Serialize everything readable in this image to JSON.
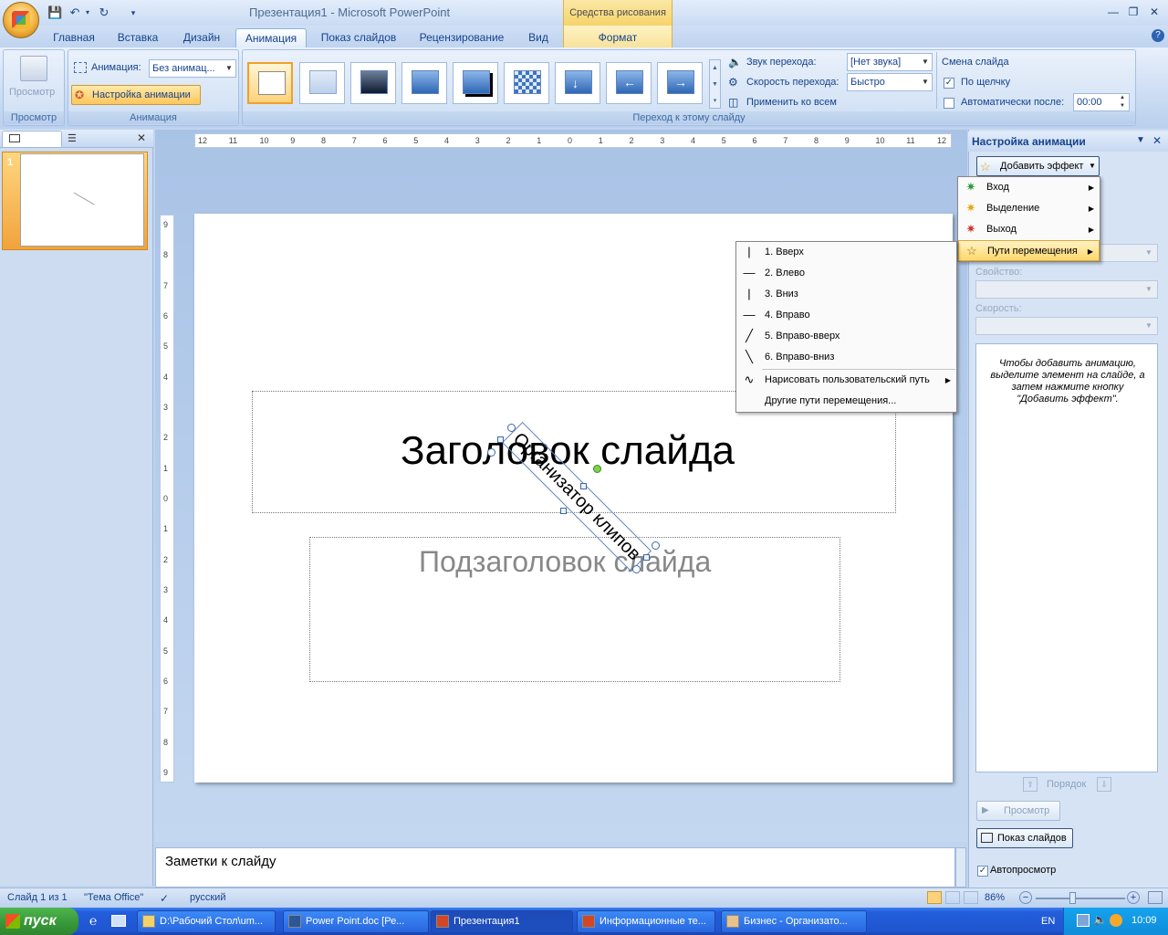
{
  "window": {
    "title": "Презентация1 - Microsoft PowerPoint",
    "contextual_tools": "Средства рисования"
  },
  "tabs": [
    "Главная",
    "Вставка",
    "Дизайн",
    "Анимация",
    "Показ слайдов",
    "Рецензирование",
    "Вид",
    "Формат"
  ],
  "active_tab": "Анимация",
  "ribbon": {
    "preview": {
      "button": "Просмотр",
      "group": "Просмотр"
    },
    "animations": {
      "animation_label": "Анимация:",
      "animation_value": "Без анимац...",
      "custom_button": "Настройка анимации",
      "group": "Анимация"
    },
    "transitions": {
      "group": "Переход к этому слайду",
      "sound_label": "Звук перехода:",
      "sound_value": "[Нет звука]",
      "speed_label": "Скорость перехода:",
      "speed_value": "Быстро",
      "apply_all": "Применить ко всем"
    },
    "advance": {
      "title": "Смена слайда",
      "on_click": "По щелчку",
      "on_click_checked": true,
      "auto_after": "Автоматически после:",
      "auto_checked": false,
      "time": "00:00"
    }
  },
  "slides_pane": {
    "slide_number": "1"
  },
  "ruler": {
    "h_ticks": [
      "12",
      "11",
      "10",
      "9",
      "8",
      "7",
      "6",
      "5",
      "4",
      "3",
      "2",
      "1",
      "0",
      "1",
      "2",
      "3",
      "4",
      "5",
      "6",
      "7",
      "8",
      "9",
      "10",
      "11",
      "12"
    ],
    "v_ticks": [
      "9",
      "8",
      "7",
      "6",
      "5",
      "4",
      "3",
      "2",
      "1",
      "0",
      "1",
      "2",
      "3",
      "4",
      "5",
      "6",
      "7",
      "8",
      "9"
    ]
  },
  "slide": {
    "title": "Заголовок слайда",
    "subtitle": "Подзаголовок слайда",
    "rotated_text": "Организатор клипов"
  },
  "notes": "Заметки к слайду",
  "task_pane": {
    "title": "Настройка анимации",
    "add_effect": "Добавить эффект",
    "property_label": "Свойство:",
    "speed_label": "Скорость:",
    "hint": "Чтобы добавить анимацию, выделите элемент на слайде, а затем нажмите кнопку \"Добавить эффект\".",
    "order": "Порядок",
    "preview": "Просмотр",
    "slideshow": "Показ слайдов",
    "autopreview": "Автопросмотр",
    "autopreview_checked": true
  },
  "effect_menu": [
    {
      "label": "Вход",
      "icon": "star-green-icon"
    },
    {
      "label": "Выделение",
      "icon": "star-yellow-icon"
    },
    {
      "label": "Выход",
      "icon": "star-red-icon"
    },
    {
      "label": "Пути перемещения",
      "icon": "star-outline-icon",
      "highlighted": true
    }
  ],
  "motion_paths_menu": [
    {
      "label": "1. Вверх",
      "icon": "line-vertical-icon"
    },
    {
      "label": "2. Влево",
      "icon": "line-horizontal-icon"
    },
    {
      "label": "3. Вниз",
      "icon": "line-vertical-icon"
    },
    {
      "label": "4. Вправо",
      "icon": "line-horizontal-icon"
    },
    {
      "label": "5. Вправо-вверх",
      "icon": "line-diagonal-up-icon"
    },
    {
      "label": "6. Вправо-вниз",
      "icon": "line-diagonal-down-icon"
    },
    {
      "label": "Нарисовать пользовательский путь",
      "icon": "curve-path-icon",
      "submenu": true
    },
    {
      "label": "Другие пути перемещения...",
      "icon": ""
    }
  ],
  "statusbar": {
    "slide_info": "Слайд 1 из 1",
    "theme": "\"Тема Office\"",
    "language": "русский",
    "zoom": "86%"
  },
  "taskbar": {
    "start": "пуск",
    "items": [
      "D:\\Рабочий Стол\\um...",
      "Power Point.doc [Ре...",
      "Презентация1",
      "Информационные те...",
      "Бизнес - Организато..."
    ],
    "active_index": 2,
    "lang": "EN",
    "clock": "10:09"
  }
}
